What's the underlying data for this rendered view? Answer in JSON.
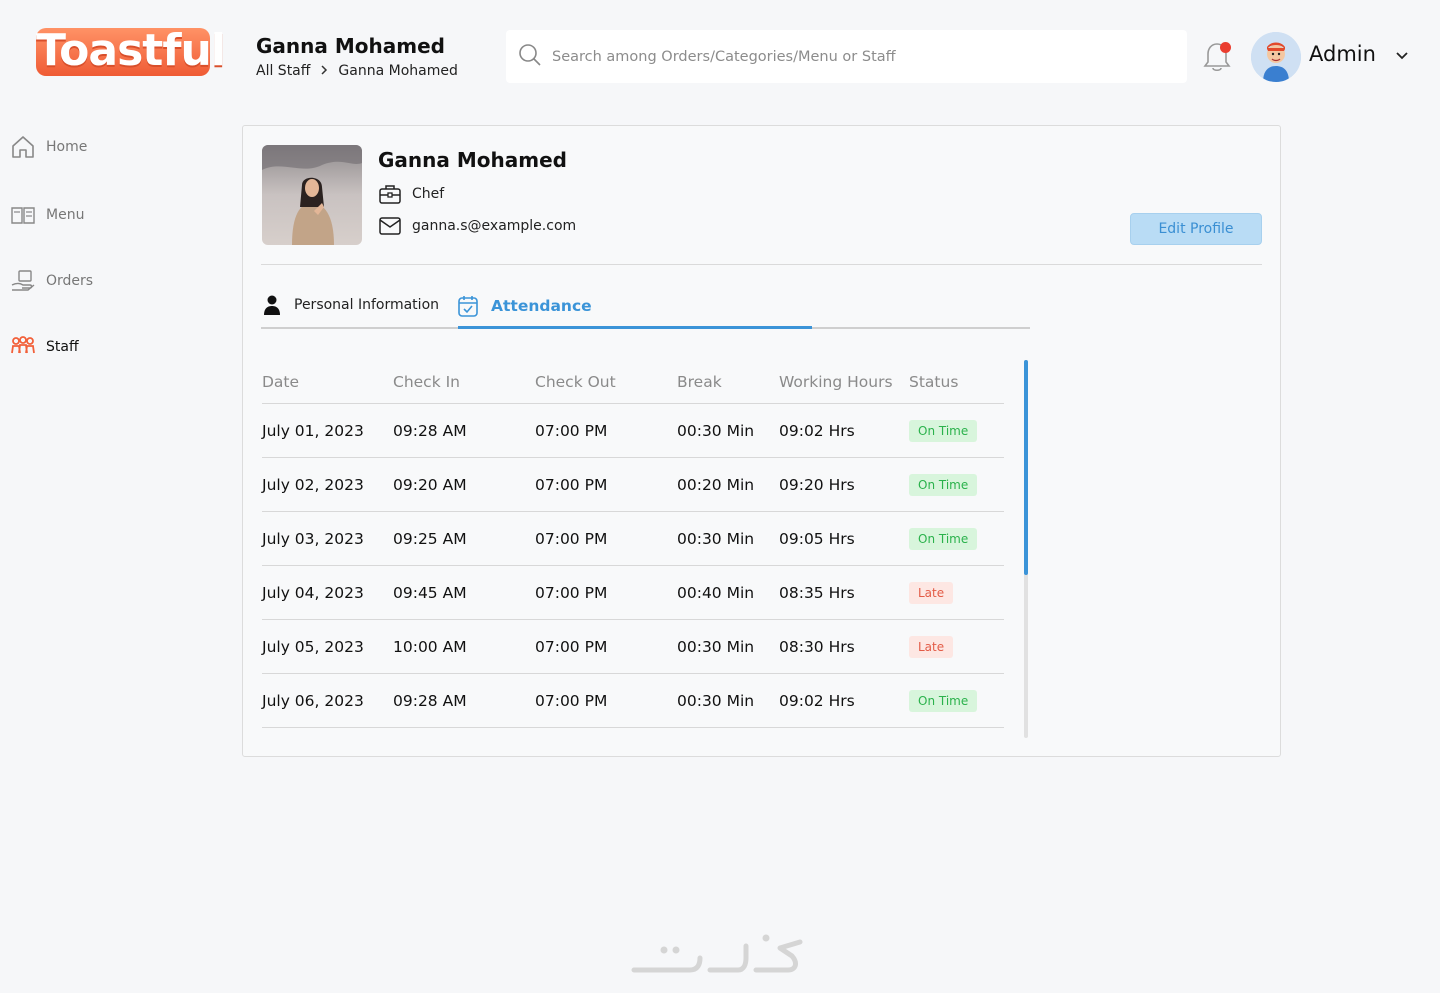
{
  "app": {
    "logo_text": "Toastful",
    "brand_color": "#f2603a",
    "accent_color": "#3b94d8"
  },
  "header": {
    "title": "Ganna Mohamed",
    "breadcrumb": [
      "All Staff",
      "Ganna Mohamed"
    ],
    "search_placeholder": "Search among Orders/Categories/Menu or Staff",
    "notification_icon": "bell-icon",
    "user_name": "Admin"
  },
  "sidebar": {
    "items": [
      {
        "label": "Home",
        "icon": "home-icon",
        "active": false
      },
      {
        "label": "Menu",
        "icon": "book-icon",
        "active": false
      },
      {
        "label": "Orders",
        "icon": "orders-icon",
        "active": false
      },
      {
        "label": "Staff",
        "icon": "staff-icon",
        "active": true
      }
    ]
  },
  "profile": {
    "name": "Ganna Mohamed",
    "role": "Chef",
    "email": "ganna.s@example.com",
    "edit_label": "Edit Profile"
  },
  "tabs": [
    {
      "label": "Personal Information",
      "active": false
    },
    {
      "label": "Attendance",
      "active": true
    }
  ],
  "attendance": {
    "columns": [
      "Date",
      "Check In",
      "Check Out",
      "Break",
      "Working Hours",
      "Status"
    ],
    "rows": [
      {
        "date": "July 01, 2023",
        "check_in": "09:28 AM",
        "check_out": "07:00 PM",
        "break": "00:30 Min",
        "hours": "09:02 Hrs",
        "status": "On Time"
      },
      {
        "date": "July 02, 2023",
        "check_in": "09:20 AM",
        "check_out": "07:00 PM",
        "break": "00:20 Min",
        "hours": "09:20 Hrs",
        "status": "On Time"
      },
      {
        "date": "July 03, 2023",
        "check_in": "09:25 AM",
        "check_out": "07:00 PM",
        "break": "00:30 Min",
        "hours": "09:05 Hrs",
        "status": "On Time"
      },
      {
        "date": "July 04, 2023",
        "check_in": "09:45 AM",
        "check_out": "07:00 PM",
        "break": "00:40 Min",
        "hours": "08:35 Hrs",
        "status": "Late"
      },
      {
        "date": "July 05, 2023",
        "check_in": "10:00 AM",
        "check_out": "07:00 PM",
        "break": "00:30 Min",
        "hours": "08:30 Hrs",
        "status": "Late"
      },
      {
        "date": "July 06, 2023",
        "check_in": "09:28 AM",
        "check_out": "07:00 PM",
        "break": "00:30 Min",
        "hours": "09:02 Hrs",
        "status": "On Time"
      }
    ]
  },
  "watermark_text": "خمسات"
}
